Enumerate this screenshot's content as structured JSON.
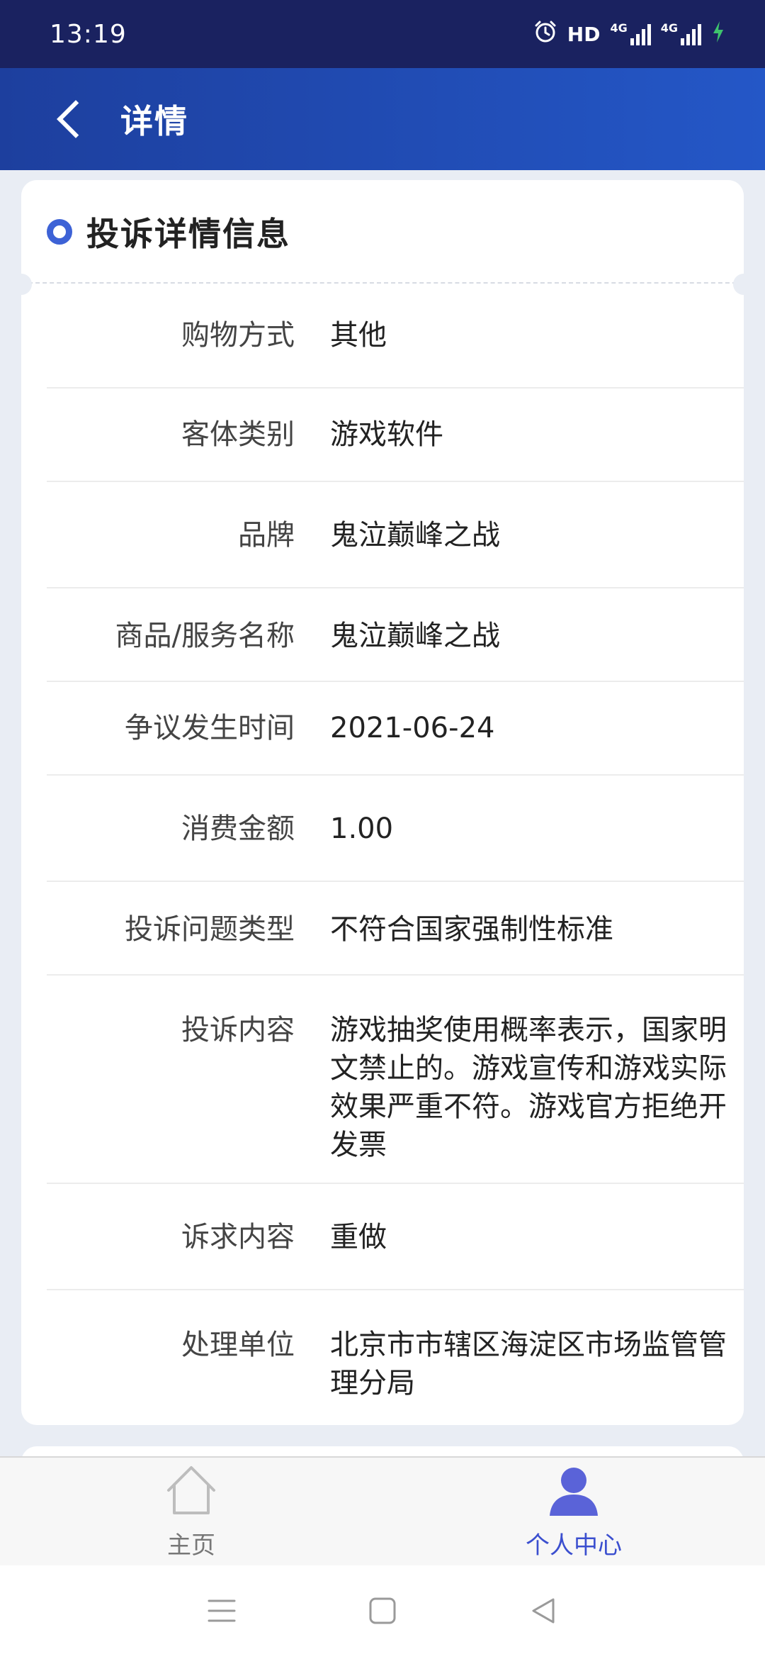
{
  "status_bar": {
    "time": "13:19",
    "hd_label": "HD",
    "network_1": "4G",
    "network_2": "4G",
    "icons": [
      "alarm-icon",
      "hd-icon",
      "signal-icon",
      "signal-icon",
      "charging-icon"
    ]
  },
  "header": {
    "back_icon": "chevron-left-icon",
    "title": "详情"
  },
  "card": {
    "title": "投诉详情信息",
    "rows": [
      {
        "label": "购物方式",
        "value": "其他"
      },
      {
        "label": "客体类别",
        "value": "游戏软件"
      },
      {
        "label": "品牌",
        "value": "鬼泣巅峰之战"
      },
      {
        "label": "商品/服务名称",
        "value": "鬼泣巅峰之战"
      },
      {
        "label": "争议发生时间",
        "value": "2021-06-24"
      },
      {
        "label": "消费金额",
        "value": "1.00"
      },
      {
        "label": "投诉问题类型",
        "value": "不符合国家强制性标准"
      },
      {
        "label": "投诉内容",
        "value": "游戏抽奖使用概率表示，国家明文禁止的。游戏宣传和游戏实际效果严重不符。游戏官方拒绝开发票"
      },
      {
        "label": "诉求内容",
        "value": "重做"
      },
      {
        "label": "处理单位",
        "value": "北京市市辖区海淀区市场监管管理分局"
      }
    ]
  },
  "bottom_nav": {
    "home_label": "主页",
    "me_label": "个人中心",
    "active_color": "#3b4fcf"
  },
  "system_nav": [
    "menu-icon",
    "home-square-icon",
    "back-triangle-icon"
  ]
}
